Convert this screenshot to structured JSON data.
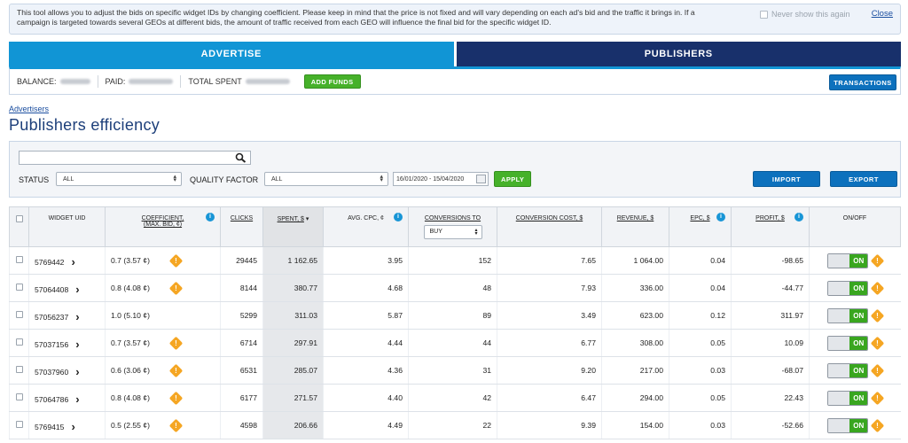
{
  "notice": {
    "text": "This tool allows you to adjust the bids on specific widget IDs by changing coefficient. Please keep in mind that the price is not fixed and will vary depending on each ad's bid and the traffic it brings in. If a campaign is targeted towards several GEOs at different bids, the amount of traffic received from each GEO will influence the final bid for the specific widget ID.",
    "never_show": "Never show this again",
    "close": "Close"
  },
  "tabs": {
    "advertise": "ADVERTISE",
    "publishers": "PUBLISHERS"
  },
  "balance": {
    "balance_label": "BALANCE:",
    "paid_label": "PAID:",
    "spent_label": "TOTAL SPENT",
    "add_funds": "ADD FUNDS",
    "transactions": "TRANSACTIONS"
  },
  "breadcrumb": "Advertisers",
  "page_title": "Publishers efficiency",
  "filters": {
    "search_value": "",
    "status_label": "STATUS",
    "status_value": "ALL",
    "quality_label": "QUALITY FACTOR",
    "quality_value": "ALL",
    "date_range": "16/01/2020 - 15/04/2020",
    "apply": "APPLY",
    "import": "IMPORT",
    "export": "EXPORT"
  },
  "table": {
    "headers": {
      "widget": "WIDGET UID",
      "coef1": "COEFFICIENT,",
      "coef2": "(MAX. BID, ¢)",
      "clicks": "CLICKS",
      "spent": "SPENT, $",
      "cpc": "AVG. CPC, ¢",
      "conversions": "CONVERSIONS TO",
      "conversions_select": "BUY",
      "conv_cost": "CONVERSION COST, $",
      "revenue": "REVENUE, $",
      "epc": "EPC, $",
      "profit": "PROFIT, $",
      "onoff": "ON/OFF"
    },
    "toggle_label": "ON",
    "rows": [
      {
        "uid": "5769442",
        "coef": "0.7 (3.57 ¢)",
        "warn": true,
        "clicks": "29445",
        "spent": "1 162.65",
        "cpc": "3.95",
        "conv": "152",
        "cost": "7.65",
        "revenue": "1 064.00",
        "epc": "0.04",
        "profit": "-98.65"
      },
      {
        "uid": "57064408",
        "coef": "0.8 (4.08 ¢)",
        "warn": true,
        "clicks": "8144",
        "spent": "380.77",
        "cpc": "4.68",
        "conv": "48",
        "cost": "7.93",
        "revenue": "336.00",
        "epc": "0.04",
        "profit": "-44.77"
      },
      {
        "uid": "57056237",
        "coef": "1.0 (5.10 ¢)",
        "warn": false,
        "clicks": "5299",
        "spent": "311.03",
        "cpc": "5.87",
        "conv": "89",
        "cost": "3.49",
        "revenue": "623.00",
        "epc": "0.12",
        "profit": "311.97"
      },
      {
        "uid": "57037156",
        "coef": "0.7 (3.57 ¢)",
        "warn": true,
        "clicks": "6714",
        "spent": "297.91",
        "cpc": "4.44",
        "conv": "44",
        "cost": "6.77",
        "revenue": "308.00",
        "epc": "0.05",
        "profit": "10.09"
      },
      {
        "uid": "57037960",
        "coef": "0.6 (3.06 ¢)",
        "warn": true,
        "clicks": "6531",
        "spent": "285.07",
        "cpc": "4.36",
        "conv": "31",
        "cost": "9.20",
        "revenue": "217.00",
        "epc": "0.03",
        "profit": "-68.07"
      },
      {
        "uid": "57064786",
        "coef": "0.8 (4.08 ¢)",
        "warn": true,
        "clicks": "6177",
        "spent": "271.57",
        "cpc": "4.40",
        "conv": "42",
        "cost": "6.47",
        "revenue": "294.00",
        "epc": "0.05",
        "profit": "22.43"
      },
      {
        "uid": "5769415",
        "coef": "0.5 (2.55 ¢)",
        "warn": true,
        "clicks": "4598",
        "spent": "206.66",
        "cpc": "4.49",
        "conv": "22",
        "cost": "9.39",
        "revenue": "154.00",
        "epc": "0.03",
        "profit": "-52.66"
      }
    ]
  }
}
